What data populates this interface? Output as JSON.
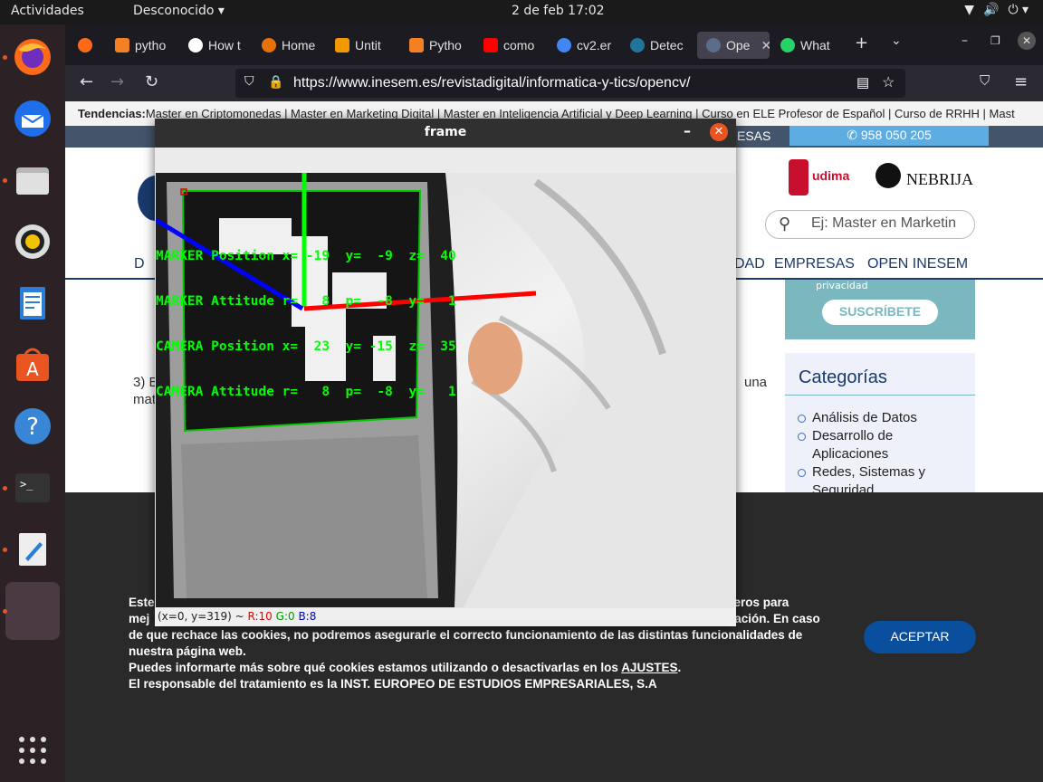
{
  "topbar": {
    "activities": "Actividades",
    "app_menu": "Desconocido ▾",
    "clock": "2 de feb  17:02"
  },
  "tabs": [
    {
      "label": "pytho",
      "favicon_color": "#f48024"
    },
    {
      "label": "How t",
      "favicon_color": "#ffffff"
    },
    {
      "label": "Home",
      "favicon_color": "#e8710a"
    },
    {
      "label": "Untit",
      "favicon_color": "#f29900"
    },
    {
      "label": "Pytho",
      "favicon_color": "#f48024"
    },
    {
      "label": "como",
      "favicon_color": "#ff0000"
    },
    {
      "label": "cv2.er",
      "favicon_color": "#4285f4"
    },
    {
      "label": "Detec",
      "favicon_color": "#21759b"
    },
    {
      "label": "Ope",
      "favicon_color": "#5a6e8c",
      "active": true
    },
    {
      "label": "What",
      "favicon_color": "#25d366"
    }
  ],
  "browser": {
    "url": "https://www.inesem.es/revistadigital/informatica-y-tics/opencv/"
  },
  "page": {
    "trends_label": "Tendencias:",
    "trends_text": "Master en Criptomonedas | Master en Marketing Digital | Master en Inteligencia Artificial y Deep Learning | Curso en ELE Profesor de Español | Curso de RRHH | Mast",
    "header_emp_stub": "ESAS",
    "phone": "958 050 205",
    "logo_udima": "udima",
    "logo_nebrija": "NEBRIJA",
    "search_placeholder": "Ej: Master en Marketin",
    "menu_left": "D",
    "menu_items": [
      "DAD",
      "EMPRESAS",
      "OPEN INESEM"
    ],
    "newsletter_small": "privacidad",
    "subscribe": "SUSCRÍBETE",
    "categories_title": "Categorías",
    "categories": [
      "Análisis de Datos",
      "Desarrollo de Aplicaciones",
      "Redes, Sistemas y Seguridad"
    ],
    "article_snippet": "3) E",
    "article_snippet2": "mat",
    "article_right": "una",
    "cookie_line1": "Este",
    "cookie_line1b": "ceros para",
    "cookie_line2": "mej",
    "cookie_line2b": "gación. En caso",
    "cookie_line3": "de que rechace las cookies, no podremos asegurarle el correcto funcionamiento de las distintas funcionalidades de",
    "cookie_line4": "nuestra página web.",
    "cookie_line5a": "Puedes informarte más sobre qué cookies estamos utilizando o desactivarlas en los ",
    "cookie_link": "AJUSTES",
    "cookie_line6": "El responsable del tratamiento es la INST. EUROPEO DE ESTUDIOS EMPRESARIALES, S.A",
    "accept": "ACEPTAR"
  },
  "cv_window": {
    "title": "frame",
    "overlay": [
      "MARKER Position x= -19  y=  -9  z=  40",
      "MARKER Attitude r=   8  p=  -8  y=   1",
      "CAMERA Position x=  23  y= -15  z=  35",
      "CAMERA Attitude r=   8  p=  -8  y=   1"
    ],
    "status_coords": "(x=0, y=319) ~ ",
    "status_r": "R:10",
    "status_g": "G:0",
    "status_b": "B:8"
  }
}
